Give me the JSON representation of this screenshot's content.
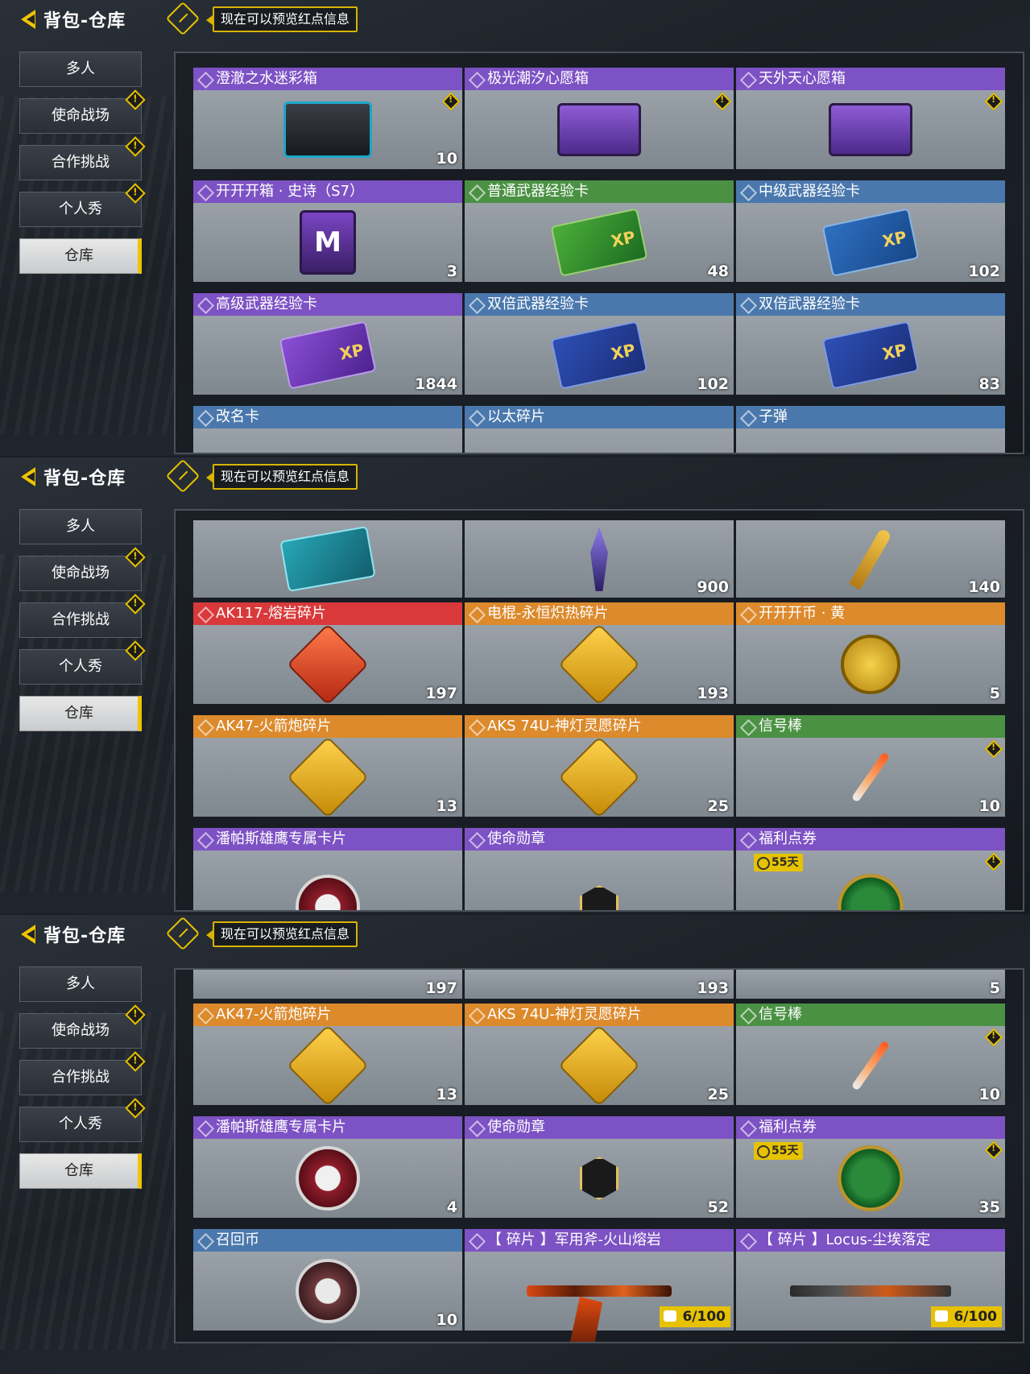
{
  "header": {
    "title": "背包-仓库",
    "hint": "现在可以预览红点信息"
  },
  "nav": [
    {
      "label": "多人",
      "badge": false,
      "active": false
    },
    {
      "label": "使命战场",
      "badge": true,
      "active": false
    },
    {
      "label": "合作挑战",
      "badge": true,
      "active": false
    },
    {
      "label": "个人秀",
      "badge": true,
      "active": false
    },
    {
      "label": "仓库",
      "badge": false,
      "active": true
    }
  ],
  "screen1": {
    "rows": [
      [
        {
          "name": "澄澈之水迷彩箱",
          "color": "purple",
          "count": "10",
          "icon": "chest-icon",
          "warn": true
        },
        {
          "name": "极光潮汐心愿箱",
          "color": "purple",
          "count": "",
          "icon": "chest-icon",
          "warn": true
        },
        {
          "name": "天外天心愿箱",
          "color": "purple",
          "count": "",
          "icon": "chest-icon",
          "warn": true
        }
      ],
      [
        {
          "name": "开开开箱 · 史诗（S7）",
          "color": "purple",
          "count": "3",
          "icon": "mbox-icon"
        },
        {
          "name": "普通武器经验卡",
          "color": "green",
          "count": "48",
          "icon": "xp-card-icon"
        },
        {
          "name": "中级武器经验卡",
          "color": "blue",
          "count": "102",
          "icon": "xp-card-icon"
        }
      ],
      [
        {
          "name": "高级武器经验卡",
          "color": "purple",
          "count": "1844",
          "icon": "xp-card-icon"
        },
        {
          "name": "双倍武器经验卡",
          "color": "blue",
          "count": "102",
          "icon": "xp-card-icon"
        },
        {
          "name": "双倍武器经验卡",
          "color": "blue",
          "count": "83",
          "icon": "xp-card-icon"
        }
      ],
      [
        {
          "name": "改名卡",
          "color": "blue"
        },
        {
          "name": "以太碎片",
          "color": "blue"
        },
        {
          "name": "子弹",
          "color": "blue"
        }
      ]
    ]
  },
  "screen2": {
    "top_counts": [
      "",
      "900",
      "140"
    ],
    "rows": [
      [
        {
          "name": "AK117-熔岩碎片",
          "color": "red",
          "count": "197"
        },
        {
          "name": "电棍-永恒炽热碎片",
          "color": "orange",
          "count": "193"
        },
        {
          "name": "开开开币 · 黄",
          "color": "orange",
          "count": "5"
        }
      ],
      [
        {
          "name": "AK47-火箭炮碎片",
          "color": "orange",
          "count": "13"
        },
        {
          "name": "AKS 74U-神灯灵愿碎片",
          "color": "orange",
          "count": "25"
        },
        {
          "name": "信号棒",
          "color": "green",
          "count": "10",
          "warn": true
        }
      ],
      [
        {
          "name": "潘帕斯雄鹰专属卡片",
          "color": "purple"
        },
        {
          "name": "使命勋章",
          "color": "purple"
        },
        {
          "name": "福利点券",
          "color": "purple",
          "timer": "55天",
          "warn": true
        }
      ]
    ]
  },
  "screen3": {
    "top_counts": [
      "197",
      "193",
      "5"
    ],
    "rows": [
      [
        {
          "name": "AK47-火箭炮碎片",
          "color": "orange",
          "count": "13"
        },
        {
          "name": "AKS 74U-神灯灵愿碎片",
          "color": "orange",
          "count": "25"
        },
        {
          "name": "信号棒",
          "color": "green",
          "count": "10",
          "warn": true
        }
      ],
      [
        {
          "name": "潘帕斯雄鹰专属卡片",
          "color": "purple",
          "count": "4"
        },
        {
          "name": "使命勋章",
          "color": "purple",
          "count": "52"
        },
        {
          "name": "福利点券",
          "color": "purple",
          "count": "35",
          "timer": "55天",
          "warn": true
        }
      ],
      [
        {
          "name": "召回币",
          "color": "blue",
          "count": "10"
        },
        {
          "name": "【 碎片 】军用斧-火山熔岩",
          "color": "purple",
          "frag": "6/100"
        },
        {
          "name": "【 碎片 】Locus-尘埃落定",
          "color": "purple",
          "frag": "6/100"
        }
      ]
    ]
  }
}
